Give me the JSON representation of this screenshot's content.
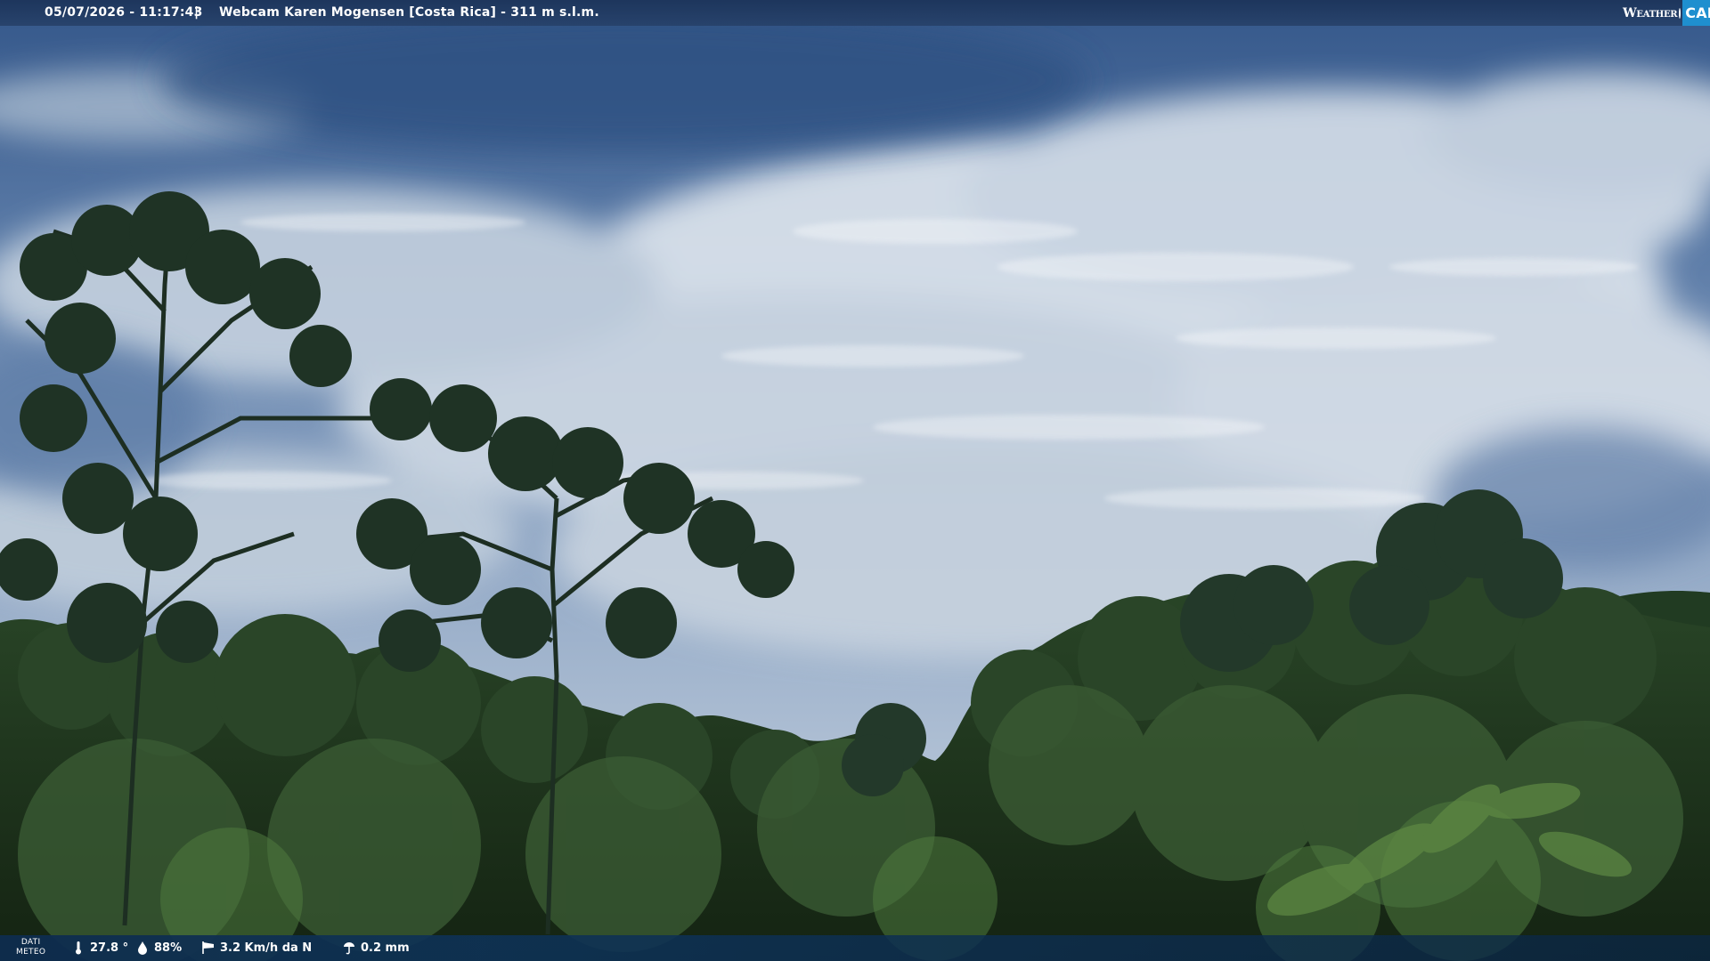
{
  "header": {
    "datetime": "05/07/2026 - 11:17:43",
    "separator": "|",
    "title": "Webcam Karen Mogensen [Costa Rica] - 311 m s.l.m.",
    "brand_weather": "Weather",
    "brand_cam": "CAM"
  },
  "weather": {
    "label_line1": "DATI",
    "label_line2": "METEO",
    "temperature": "27.8 °",
    "humidity": "88%",
    "wind": "3.2 Km/h da N",
    "rain": "0.2 mm"
  },
  "icons": {
    "temperature": "thermometer-icon",
    "humidity": "water-drop-icon",
    "wind": "wind-sock-icon",
    "rain": "rain-gauge-icon"
  },
  "colors": {
    "brand_accent": "#1f8fcf",
    "bar_background": "#1c345a"
  }
}
